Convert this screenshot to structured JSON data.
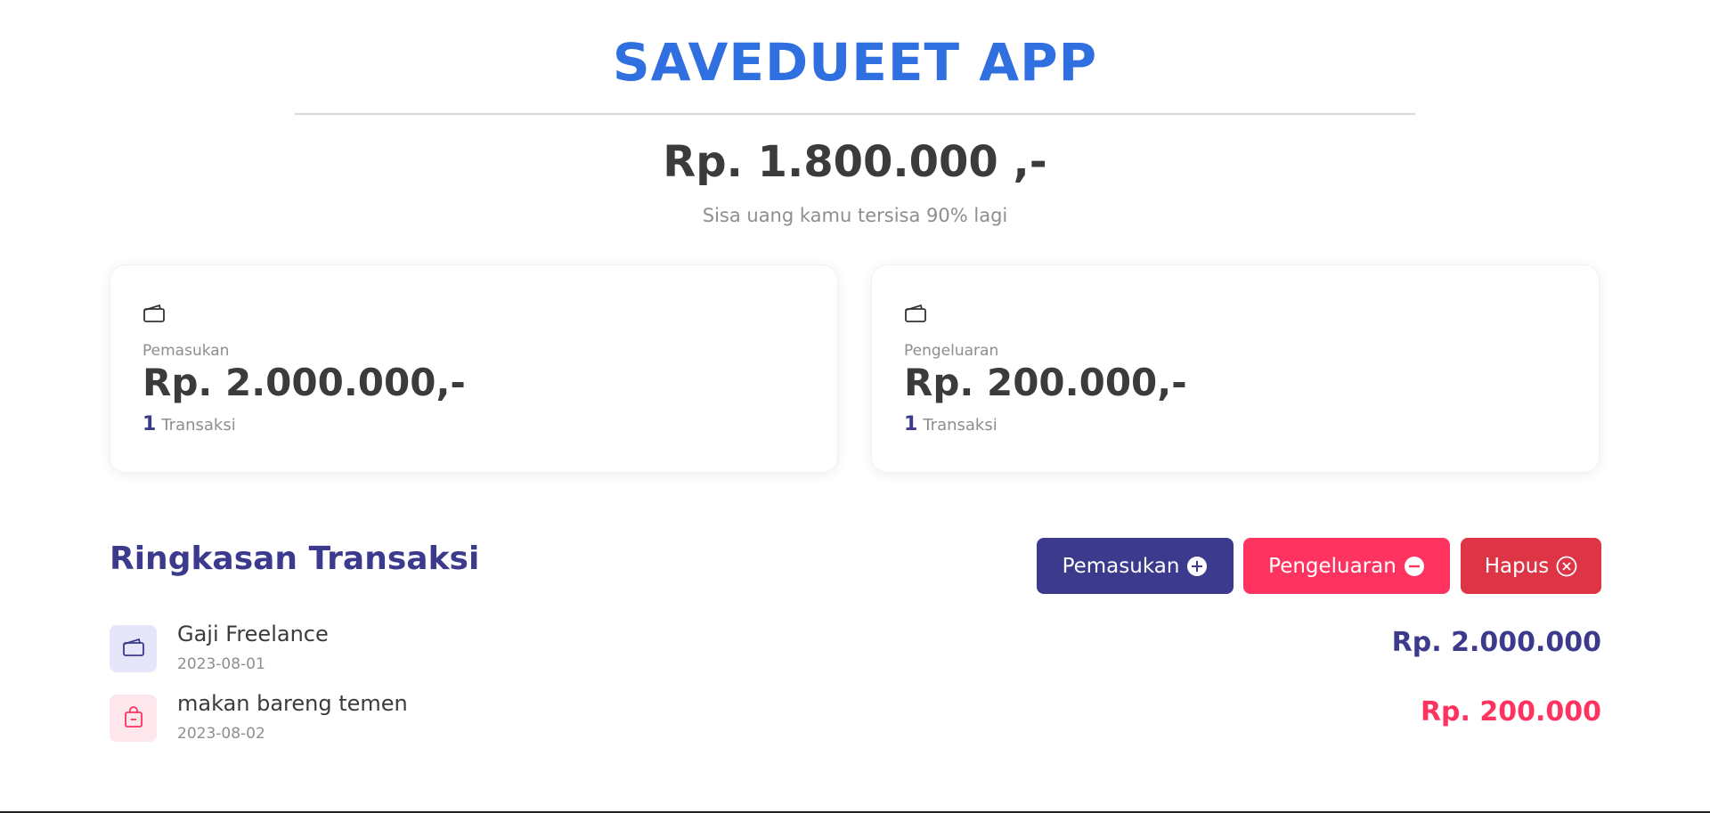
{
  "app": {
    "title": "SAVEDUEET APP",
    "title_color": "#2f6fe0"
  },
  "summary": {
    "balance": "Rp. 1.800.000 ,-",
    "remaining_text": "Sisa uang kamu tersisa 90% lagi"
  },
  "cards": {
    "income": {
      "icon": "wallet-icon",
      "label": "Pemasukan",
      "amount": "Rp. 2.000.000,-",
      "count": "1",
      "count_label": "Transaksi"
    },
    "expense": {
      "icon": "wallet-icon",
      "label": "Pengeluaran",
      "amount": "Rp. 200.000,-",
      "count": "1",
      "count_label": "Transaksi"
    }
  },
  "transactions_section": {
    "title": "Ringkasan Transaksi",
    "buttons": {
      "income": {
        "label": "Pemasukan",
        "icon": "plus-circle-icon",
        "color": "#3c3a8c"
      },
      "expense": {
        "label": "Pengeluaran",
        "icon": "minus-circle-icon",
        "color": "#fe3360"
      },
      "delete": {
        "label": "Hapus",
        "icon": "x-circle-icon",
        "color": "#dd3545"
      }
    },
    "items": [
      {
        "type": "income",
        "icon": "wallet-icon",
        "name": "Gaji Freelance",
        "date": "2023-08-01",
        "amount": "Rp. 2.000.000",
        "color": "#3c3a8c"
      },
      {
        "type": "expense",
        "icon": "shopping-bag-icon",
        "name": "makan bareng temen",
        "date": "2023-08-02",
        "amount": "Rp. 200.000",
        "color": "#fe3360"
      }
    ]
  }
}
